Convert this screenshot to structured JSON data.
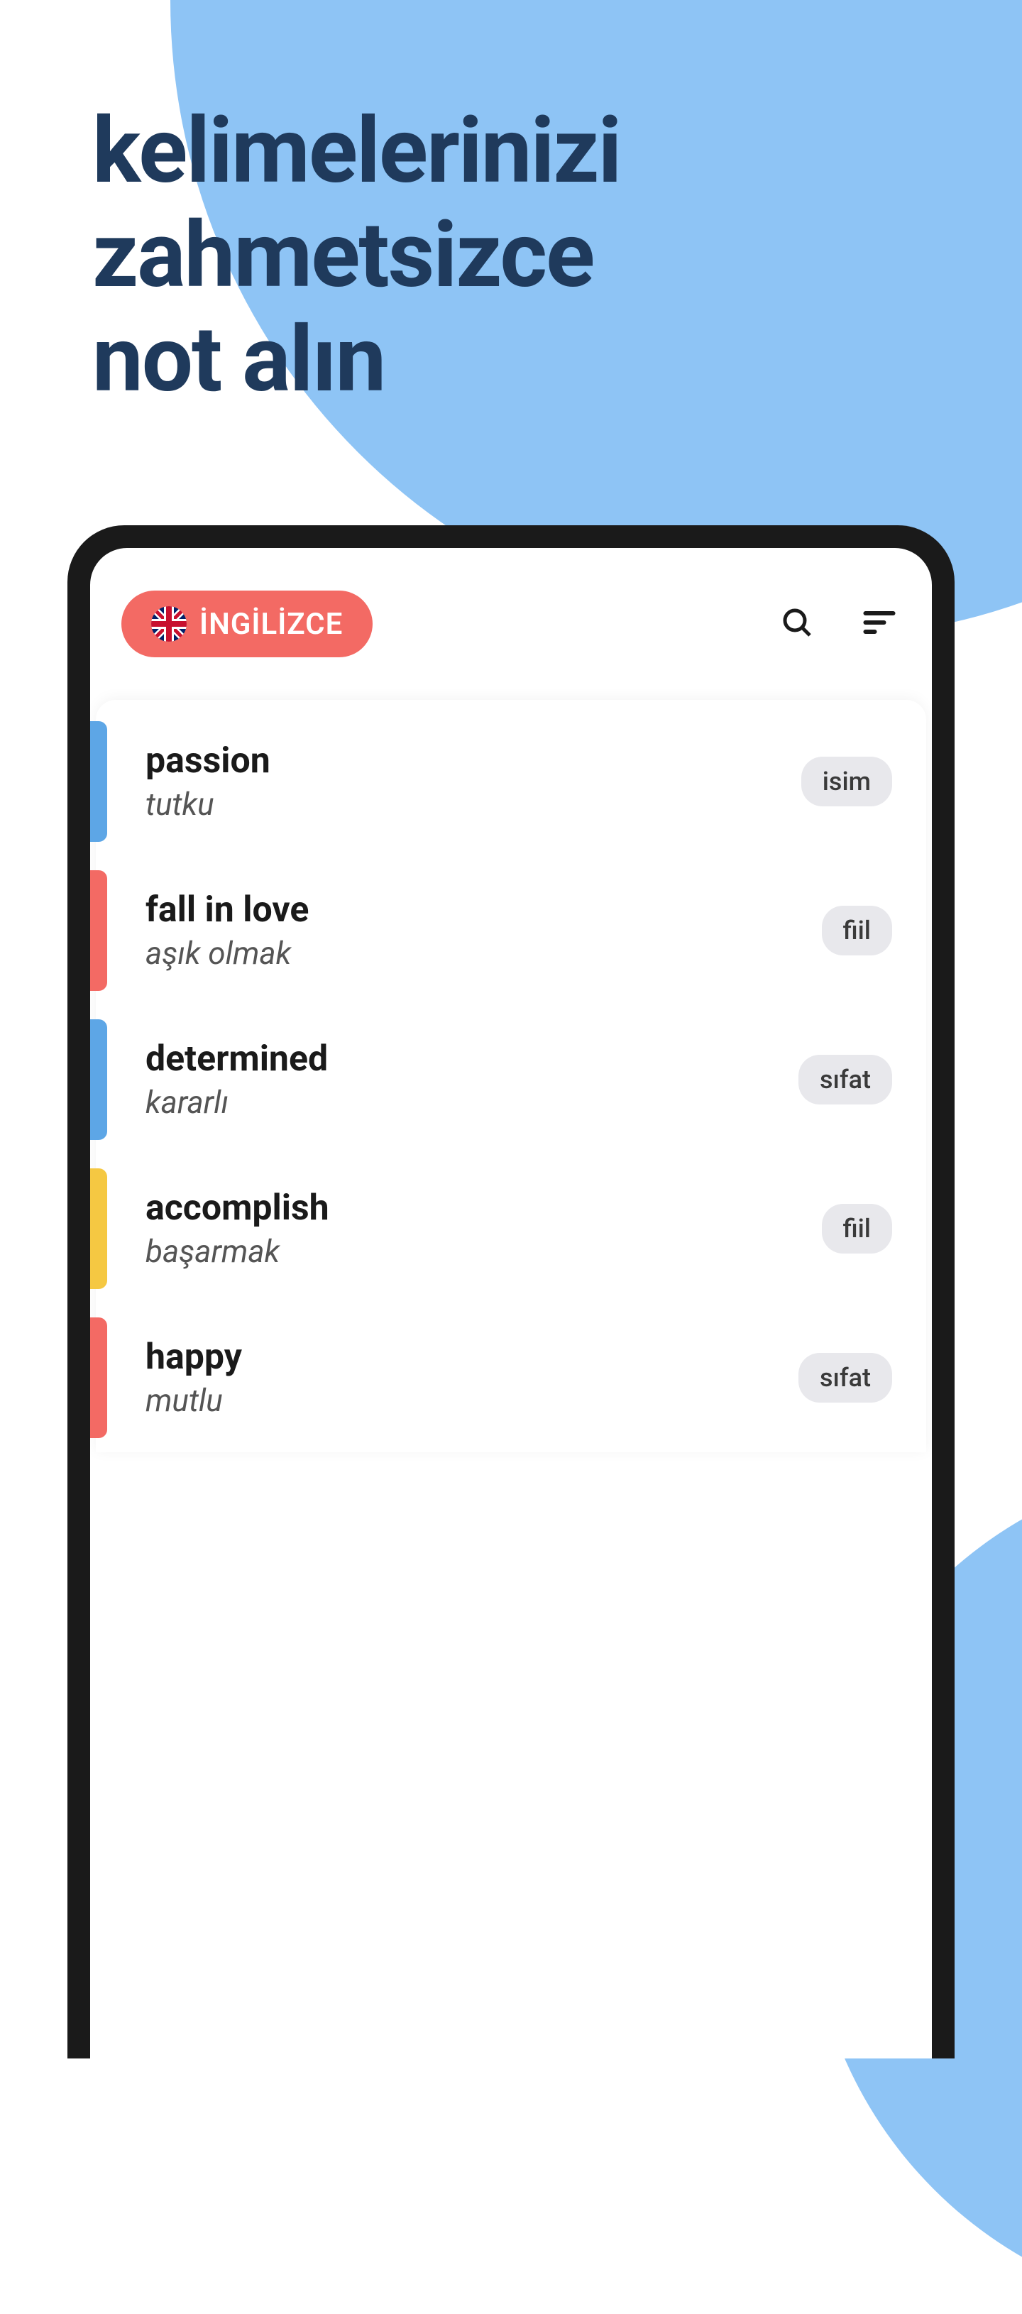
{
  "headline": {
    "line1": "kelimelerinizi",
    "line2": "zahmetsizce",
    "line3": "not alın"
  },
  "header": {
    "language_label": "İNGİLİZCE"
  },
  "words": [
    {
      "word": "passion",
      "translation": "tutku",
      "tag": "isim",
      "color": "blue"
    },
    {
      "word": "fall in love",
      "translation": "aşık olmak",
      "tag": "fiil",
      "color": "red"
    },
    {
      "word": "determined",
      "translation": "kararlı",
      "tag": "sıfat",
      "color": "blue"
    },
    {
      "word": "accomplish",
      "translation": "başarmak",
      "tag": "fiil",
      "color": "yellow"
    },
    {
      "word": "happy",
      "translation": "mutlu",
      "tag": "sıfat",
      "color": "red"
    }
  ]
}
